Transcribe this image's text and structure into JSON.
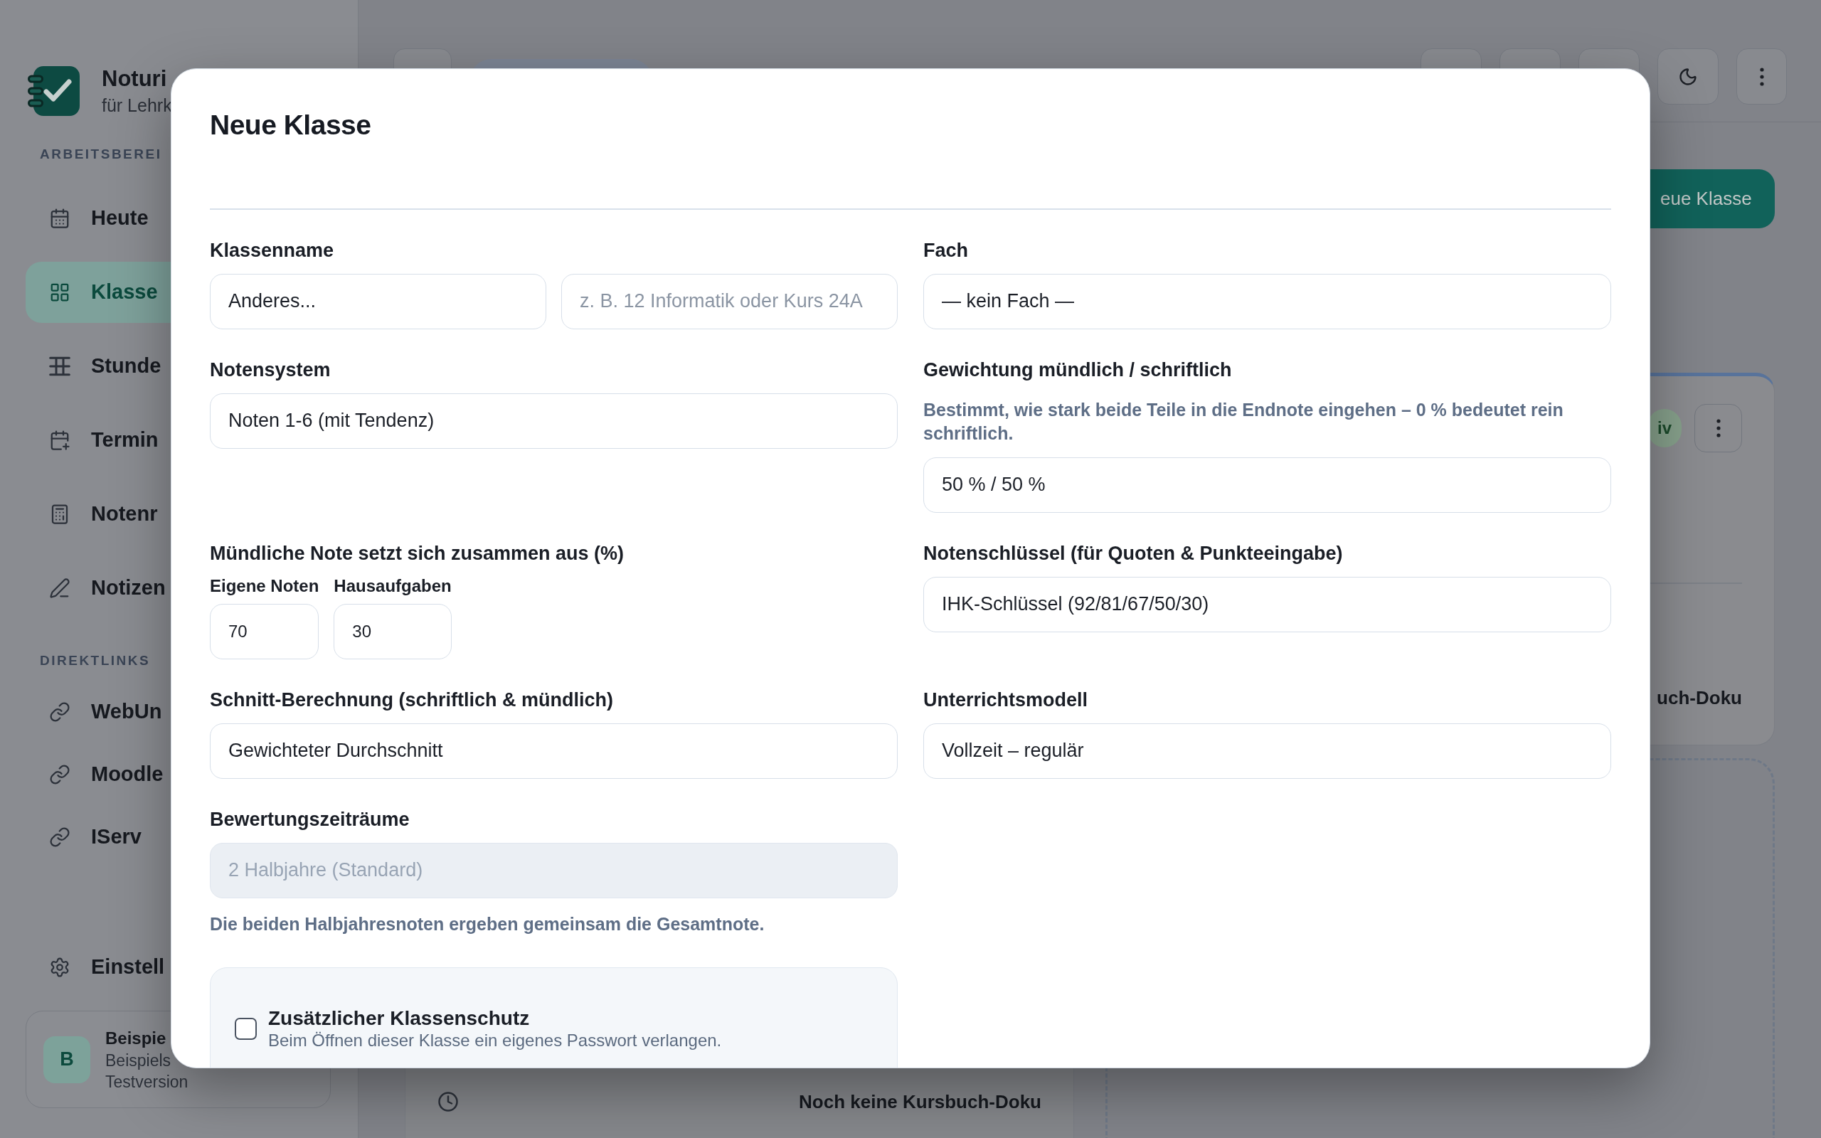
{
  "sidebar": {
    "brand": {
      "name": "Noturi",
      "subtitle": "für Lehrk"
    },
    "sections": [
      {
        "heading": "ARBEITSBEREI",
        "items": [
          {
            "label": "Heute",
            "selected": false
          },
          {
            "label": "Klasse",
            "selected": true
          },
          {
            "label": "Stunde",
            "selected": false
          },
          {
            "label": "Termin",
            "selected": false
          },
          {
            "label": "Notenr",
            "selected": false
          },
          {
            "label": "Notizen",
            "selected": false
          }
        ]
      },
      {
        "heading": "DIREKTLINKS",
        "items": [
          {
            "label": "WebUn"
          },
          {
            "label": "Moodle"
          },
          {
            "label": "IServ"
          }
        ]
      }
    ],
    "settings": {
      "label": "Einstell"
    },
    "account": {
      "avatar": "B",
      "name": "Beispie",
      "detail": "Beispiels",
      "plan": "Testversion"
    }
  },
  "main": {
    "new_class_button": "eue Klasse",
    "cards": [
      {
        "badge": "iv",
        "footer": "uch-Doku"
      },
      {
        "footer": "Noch keine Kursbuch-Doku"
      }
    ]
  },
  "modal": {
    "title": "Neue Klasse",
    "fields": [
      {
        "kind": "double",
        "label": "Klassenname",
        "inputs": [
          {
            "value": "Anderes..."
          },
          {
            "placeholder": "z. B. 12 Informatik oder Kurs 24A"
          }
        ]
      },
      {
        "kind": "select",
        "label": "Fach",
        "value": "— kein Fach —",
        "disabled": false
      },
      {
        "kind": "select",
        "label": "Notensystem",
        "value": "Noten 1-6 (mit Tendenz)",
        "disabled": false
      },
      {
        "kind": "select",
        "label": "Gewichtung mündlich / schriftlich",
        "hint": "Bestimmt, wie stark beide Teile in die Endnote eingehen – 0 % bedeutet rein schriftlich.",
        "value": "50 % / 50 %",
        "disabled": false
      },
      {
        "kind": "split",
        "label": "Mündliche Note setzt sich zusammen aus (%)",
        "parts": [
          {
            "label": "Eigene Noten",
            "value": "70"
          },
          {
            "label": "Hausaufgaben",
            "value": "30"
          }
        ]
      },
      {
        "kind": "select",
        "label": "Notenschlüssel (für Quoten & Punkteeingabe)",
        "value": "IHK-Schlüssel (92/81/67/50/30)",
        "disabled": false
      },
      {
        "kind": "select",
        "label": "Schnitt-Berechnung (schriftlich & mündlich)",
        "value": "Gewichteter Durchschnitt",
        "disabled": false
      },
      {
        "kind": "select",
        "label": "Unterrichtsmodell",
        "value": "Vollzeit – regulär",
        "disabled": false
      },
      {
        "kind": "select",
        "label": "Bewertungszeiträume",
        "value": "2 Halbjahre (Standard)",
        "disabled": true,
        "note": "Die beiden Halbjahresnoten ergeben gemeinsam die Gesamtnote."
      },
      {
        "kind": "checkbox",
        "label": "Zusätzlicher Klassenschutz",
        "description": "Beim Öffnen dieser Klasse ein eigenes Passwort verlangen.",
        "checked": false
      }
    ]
  }
}
